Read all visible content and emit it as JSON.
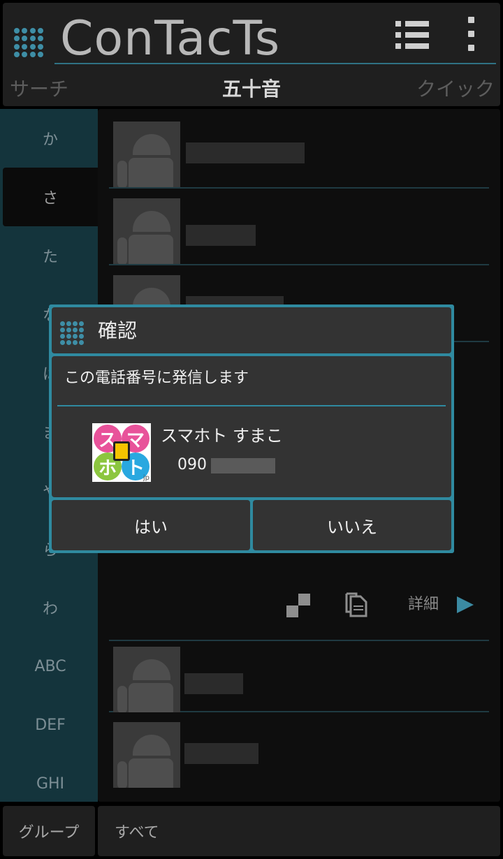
{
  "header": {
    "app_title": "ConTacTs",
    "tabs": [
      "サーチ",
      "五十音",
      "クイック"
    ],
    "active_tab": "五十音"
  },
  "sidebar": {
    "items": [
      "か",
      "さ",
      "た",
      "な",
      "は",
      "ま",
      "や",
      "ら",
      "わ",
      "ABC",
      "DEF",
      "GHI"
    ],
    "active": "さ"
  },
  "contact_actions": {
    "detail_label": "詳細"
  },
  "footer": {
    "group_label": "グループ",
    "all_label": "すべて"
  },
  "dialog": {
    "title": "確認",
    "message": "この電話番号に発信します",
    "contact_name": "スマホト すまこ",
    "phone_prefix": "090",
    "logo_chars": [
      "ス",
      "マ",
      "ホ",
      "ト"
    ],
    "logo_suffix": "jp",
    "yes_label": "はい",
    "no_label": "いいえ"
  },
  "colors": {
    "accent": "#2f8aa0",
    "sidebar_bg": "#14343c",
    "panel_bg": "#1f1f1f",
    "dialog_bg": "#333333"
  }
}
